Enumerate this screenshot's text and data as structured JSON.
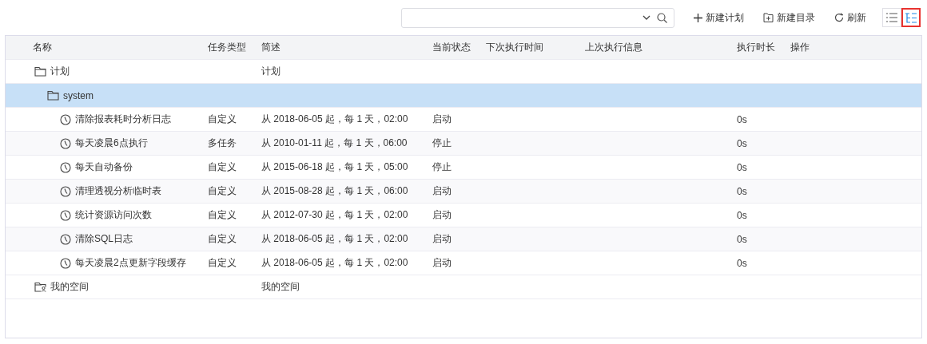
{
  "toolbar": {
    "search": {
      "dropdown": true
    },
    "buttons": [
      {
        "kind": "add",
        "label": "新建计划"
      },
      {
        "kind": "folder",
        "label": "新建目录"
      },
      {
        "kind": "refresh",
        "label": "刷新"
      }
    ],
    "views": [
      {
        "kind": "list",
        "selected": false
      },
      {
        "kind": "tree",
        "selected": true
      }
    ]
  },
  "table": {
    "columns": [
      "名称",
      "任务类型",
      "简述",
      "当前状态",
      "下次执行时间",
      "上次执行信息",
      "执行时长",
      "操作"
    ],
    "rows": [
      {
        "kind": "folder",
        "name": "计划",
        "desc": "计划",
        "selected": false,
        "children": [
          {
            "kind": "folder",
            "name": "system",
            "selected": true,
            "children": [
              {
                "kind": "task",
                "name": "清除报表耗时分析日志",
                "type": "自定义",
                "desc": "从 2018-06-05 起，每 1 天，02:00",
                "status": "启动",
                "duration": "0s",
                "selected": false
              },
              {
                "kind": "task",
                "name": "每天凌晨6点执行",
                "type": "多任务",
                "desc": "从 2010-01-11 起，每 1 天，06:00",
                "status": "停止",
                "duration": "0s",
                "selected": false
              },
              {
                "kind": "task",
                "name": "每天自动备份",
                "type": "自定义",
                "desc": "从 2015-06-18 起，每 1 天，05:00",
                "status": "停止",
                "duration": "0s",
                "selected": false
              },
              {
                "kind": "task",
                "name": "清理透视分析临时表",
                "type": "自定义",
                "desc": "从 2015-08-28 起，每 1 天，06:00",
                "status": "启动",
                "duration": "0s",
                "selected": false
              },
              {
                "kind": "task",
                "name": "统计资源访问次数",
                "type": "自定义",
                "desc": "从 2012-07-30 起，每 1 天，02:00",
                "status": "启动",
                "duration": "0s",
                "selected": false
              },
              {
                "kind": "task",
                "name": "清除SQL日志",
                "type": "自定义",
                "desc": "从 2018-06-05 起，每 1 天，02:00",
                "status": "启动",
                "duration": "0s",
                "selected": false
              },
              {
                "kind": "task",
                "name": "每天凌晨2点更新字段缓存",
                "type": "自定义",
                "desc": "从 2018-06-05 起，每 1 天，02:00",
                "status": "启动",
                "duration": "0s",
                "selected": false
              }
            ]
          }
        ]
      },
      {
        "kind": "space",
        "name": "我的空间",
        "desc": "我的空间",
        "selected": false
      }
    ]
  }
}
